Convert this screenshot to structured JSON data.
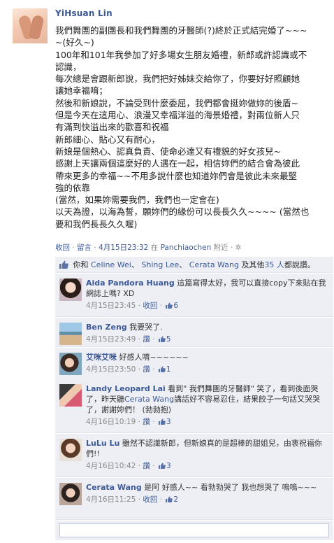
{
  "post": {
    "author": "YiHsuan Lin",
    "lines": [
      "我們舞團的副團長和我們舞團的牙醫師(?)終於正式結完婚了~~~",
      "~(好久~)",
      "100年和101年我參加了好多場女生朋友婚禮，新郎或許認識或不",
      "認識，",
      "每次總是會跟新郎說，我們把好姊妹交給你了，你要好好照顧她",
      "讓她幸福唷；",
      "然後和新娘說，不論受到什麼委屈，我們都會挺妳做妳的後盾~",
      "但是今天在這用心、浪漫又幸福洋溢的海景婚禮，對兩位新人只",
      "有滿到快溢出來的歡喜和祝福",
      "新郎細心、貼心又有耐心，",
      "新娘是個熱心、認真負責、使命必達又有禮貌的好女孩兒~",
      "感謝上天讓兩個這麼好的人遇在一起，相信妳們的結合會為彼此",
      "帶來更多的幸福~~不用多說什麼也知道妳們會是彼此未來最堅",
      "強的依靠",
      "(當然，如果妳需要我們，我們也一定會在)",
      "以天為證，以海為誓，願妳們的緣份可以長長久久~~~~ (當然也",
      "要和我們長長久久喔)"
    ],
    "meta": {
      "collapse": "收回",
      "comment": "留言",
      "time": "4月15日23:32",
      "at": "在",
      "place": "Panchiaochen",
      "near": "附近",
      "sep": "·",
      "gear": "✲"
    }
  },
  "likes": {
    "prefix": "你和",
    "names": [
      "Celine Wei",
      "Shing Lee",
      "Cerata Wang"
    ],
    "and": "及其他",
    "others": "35 人",
    "suffix": "都說讚。",
    "comma": "、"
  },
  "comments": [
    {
      "name": "Aida Pandora Huang",
      "text": "這篇寫得太好，我可以直接copy下來貼在我網誌上嗎? XD",
      "time": "4月15日23:45",
      "action": "收回",
      "likes": "6"
    },
    {
      "name": "Ben Zeng",
      "text": "我要哭了.",
      "time": "4月15日23:49",
      "action": "讚",
      "likes": "5"
    },
    {
      "name": "艾咪艾咪",
      "text": "好感人唷~~~~~~",
      "time": "4月15日23:50",
      "action": "讚",
      "likes": "1"
    },
    {
      "name": "Landy Leopard Lai",
      "text_before": "看到\" 我們舞團的牙醫師\" 笑了，看到後面哭了，昨天聽",
      "mention": "Cerata Wang",
      "text_after": "講話好不容易忍住，結果餃子一句話又哭哭了，謝謝妳們！ (勃勃抱)",
      "time": "4月16日10:19",
      "action": "讚",
      "likes": "3"
    },
    {
      "name": "LuLu Lu",
      "text": "雖然不認識新郎，但新娘真的是超棒的甜姐兒，由衷祝福你們!!",
      "time": "4月16日10:42",
      "action": "讚",
      "likes": "3"
    },
    {
      "name": "Cerata Wang",
      "text": "是阿 好感人~~ 看勃勃哭了 我也想哭了 嗚嗚~~~",
      "time": "4月16日11:25",
      "action": "收回",
      "likes": "2"
    }
  ],
  "meta_sep": "·",
  "colors": {
    "link": "#3b5998",
    "panel": "#edeff4"
  }
}
